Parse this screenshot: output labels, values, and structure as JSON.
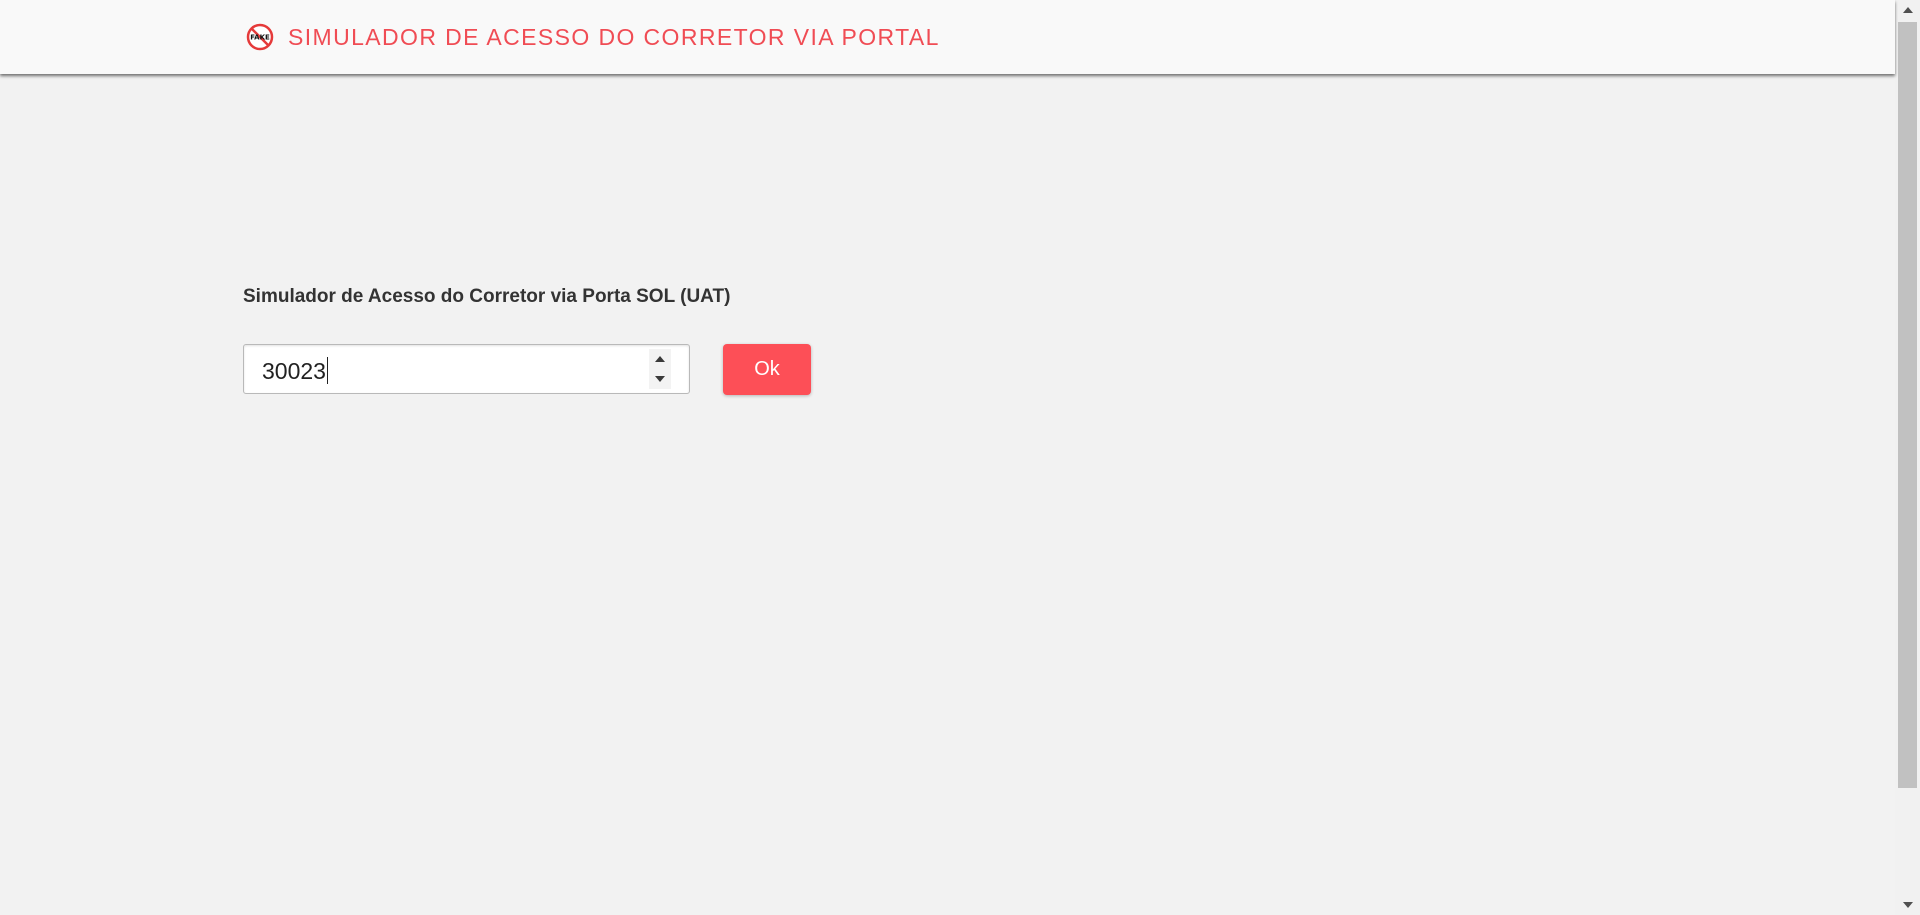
{
  "header": {
    "logo_text": "FAKE",
    "title": "SIMULADOR DE ACESSO DO CORRETOR VIA PORTAL"
  },
  "form": {
    "title": "Simulador de Acesso do Corretor via Porta SOL (UAT)",
    "broker_code": {
      "value": "30023"
    },
    "submit_label": "Ok"
  },
  "colors": {
    "brand": "#f04c54",
    "button": "#fd4f57",
    "page_background": "#f2f2f2",
    "header_background": "#f9f9f9"
  }
}
